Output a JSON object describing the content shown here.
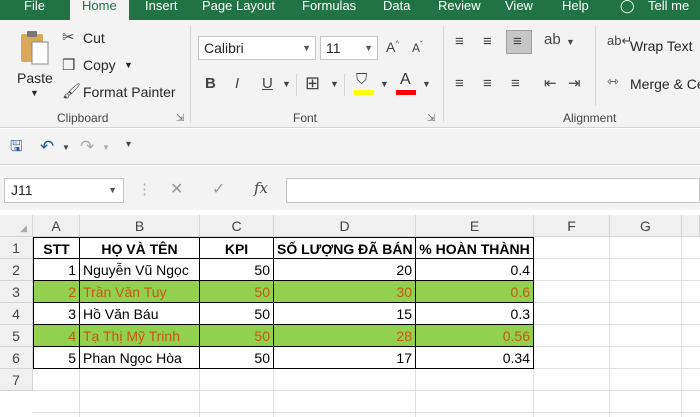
{
  "ribbon_tabs": [
    "File",
    "Home",
    "Insert",
    "Page Layout",
    "Formulas",
    "Data",
    "Review",
    "View",
    "Help"
  ],
  "tell_me": "Tell me",
  "clipboard": {
    "paste": "Paste",
    "cut": "Cut",
    "copy": "Copy",
    "format_painter": "Format Painter",
    "group": "Clipboard"
  },
  "font": {
    "name": "Calibri",
    "size": "11",
    "bold": "B",
    "italic": "I",
    "underline": "U",
    "group": "Font",
    "highlight_color": "#ffff00",
    "font_color": "#ff0000"
  },
  "alignment": {
    "wrap_text": "Wrap Text",
    "merge_center": "Merge & Ce",
    "group": "Alignment"
  },
  "formula_bar": {
    "name_box": "J11",
    "fx": "fx"
  },
  "grid": {
    "columns": [
      "A",
      "B",
      "C",
      "D",
      "E",
      "F",
      "G"
    ],
    "rows": [
      "1",
      "2",
      "3",
      "4",
      "5",
      "6",
      "7"
    ],
    "headers": [
      "STT",
      "HỌ VÀ TÊN",
      "KPI",
      "SỐ LƯỢNG ĐÃ BÁN",
      "% HOÀN THÀNH"
    ],
    "data": [
      {
        "stt": "1",
        "name": "Nguyễn Vũ Ngọc",
        "kpi": "50",
        "sold": "20",
        "pct": "0.4"
      },
      {
        "stt": "2",
        "name": "Trần Văn Tuy",
        "kpi": "50",
        "sold": "30",
        "pct": "0.6"
      },
      {
        "stt": "3",
        "name": "Hồ Văn Báu",
        "kpi": "50",
        "sold": "15",
        "pct": "0.3"
      },
      {
        "stt": "4",
        "name": "Tạ Thị Mỹ Trinh",
        "kpi": "50",
        "sold": "28",
        "pct": "0.56"
      },
      {
        "stt": "5",
        "name": "Phan Ngọc Hòa",
        "kpi": "50",
        "sold": "17",
        "pct": "0.34"
      }
    ],
    "highlight_fill": "#92d050",
    "highlight_text": "#c65911"
  }
}
